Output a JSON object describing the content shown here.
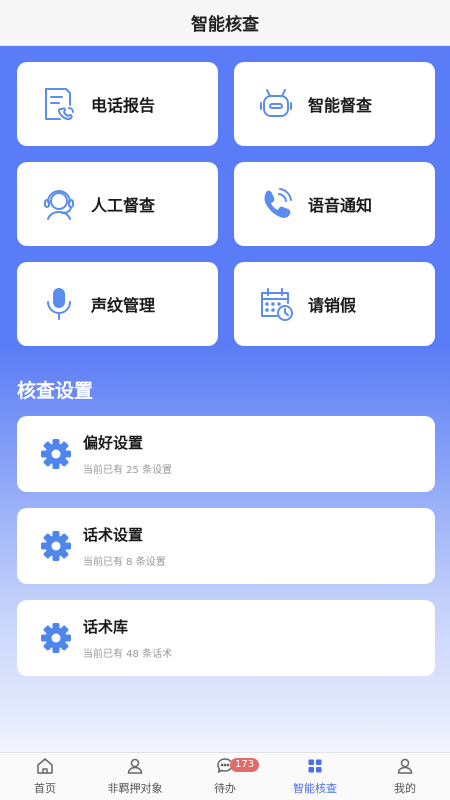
{
  "header": {
    "title": "智能核查"
  },
  "tiles": [
    {
      "label": "电话报告",
      "icon": "phone-report-icon"
    },
    {
      "label": "智能督查",
      "icon": "robot-icon"
    },
    {
      "label": "人工督查",
      "icon": "agent-headset-icon"
    },
    {
      "label": "语音通知",
      "icon": "phone-call-icon"
    },
    {
      "label": "声纹管理",
      "icon": "microphone-icon"
    },
    {
      "label": "请销假",
      "icon": "calendar-clock-icon"
    }
  ],
  "settings_section": {
    "title": "核查设置",
    "items": [
      {
        "title": "偏好设置",
        "subtitle": "当前已有 25 条设置",
        "icon": "gear-icon"
      },
      {
        "title": "话术设置",
        "subtitle": "当前已有 8 条设置",
        "icon": "gear-icon"
      },
      {
        "title": "话术库",
        "subtitle": "当前已有 48 条话术",
        "icon": "gear-icon"
      }
    ]
  },
  "tabbar": {
    "items": [
      {
        "label": "首页",
        "icon": "home-icon"
      },
      {
        "label": "非羁押对象",
        "icon": "person-icon"
      },
      {
        "label": "待办",
        "icon": "chat-icon",
        "badge": "173"
      },
      {
        "label": "智能核查",
        "icon": "grid-icon",
        "active": true
      },
      {
        "label": "我的",
        "icon": "person-icon"
      }
    ]
  },
  "colors": {
    "accent": "#4a6cf0",
    "icon_blue": "#5b8def",
    "background_blue": "#5a7cf6",
    "badge_red": "#e36a6a"
  }
}
